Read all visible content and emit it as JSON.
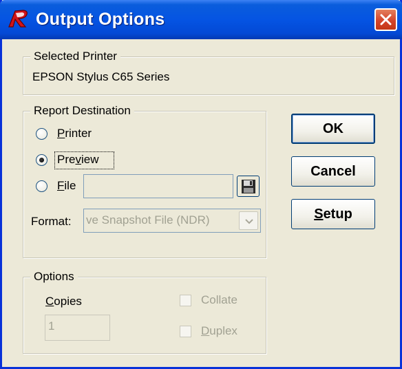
{
  "window": {
    "title": "Output Options"
  },
  "selected_printer": {
    "legend": "Selected Printer",
    "name": "EPSON Stylus C65 Series"
  },
  "report_destination": {
    "legend": "Report Destination",
    "options": [
      {
        "label": "Printer",
        "selected": false
      },
      {
        "label": "Preview",
        "selected": true
      },
      {
        "label": "File",
        "selected": false
      }
    ],
    "file_path": "",
    "format_label": "Format:",
    "format_value": "ve Snapshot File (NDR)"
  },
  "buttons": {
    "ok": "OK",
    "cancel": "Cancel",
    "setup": "Setup"
  },
  "options": {
    "legend": "Options",
    "copies_label": "Copies",
    "copies_value": "1",
    "collate_label": "Collate",
    "duplex_label": "Duplex",
    "collate_checked": false,
    "duplex_checked": false
  },
  "icons": {
    "app": "red-r-logo-icon",
    "close": "close-icon",
    "file_browse": "floppy-disk-icon",
    "combo": "chevron-down-icon"
  }
}
